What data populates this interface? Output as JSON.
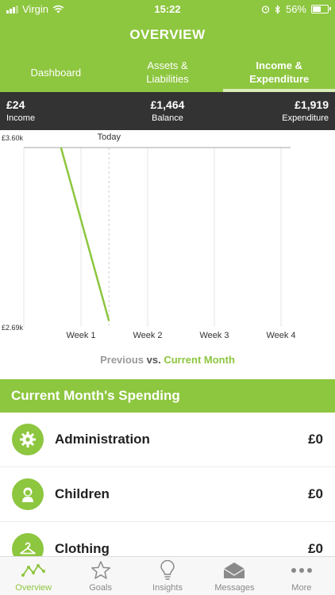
{
  "status": {
    "carrier": "Virgin",
    "time": "15:22",
    "battery": "56%",
    "battery_level": 0.56
  },
  "header": {
    "title": "OVERVIEW"
  },
  "tabs": [
    {
      "label": "Dashboard"
    },
    {
      "label": "Assets &\nLiabilities"
    },
    {
      "label": "Income &\nExpenditure"
    }
  ],
  "summary": {
    "income_value": "£24",
    "income_label": "Income",
    "balance_value": "£1,464",
    "balance_label": "Balance",
    "expenditure_value": "£1,919",
    "expenditure_label": "Expenditure"
  },
  "chart_data": {
    "type": "line",
    "ymax_label": "£3.60k",
    "ymin_label": "£2.69k",
    "ylim": [
      2690,
      3600
    ],
    "x_categories": [
      "Week 1",
      "Week 2",
      "Week 3",
      "Week 4"
    ],
    "today_label": "Today",
    "today_x": 1.42,
    "reference_line": 3600,
    "series": [
      {
        "values": [
          {
            "x": 0.7,
            "y": 3600
          },
          {
            "x": 1.42,
            "y": 2720
          }
        ],
        "color": "#8dc63f"
      }
    ]
  },
  "legend": {
    "previous": "Previous",
    "vs": "vs.",
    "current": "Current Month"
  },
  "section": {
    "title": "Current Month's Spending"
  },
  "spending": [
    {
      "label": "Administration",
      "amount": "£0",
      "icon": "gear-icon"
    },
    {
      "label": "Children",
      "amount": "£0",
      "icon": "child-icon"
    },
    {
      "label": "Clothing",
      "amount": "£0",
      "icon": "hanger-icon"
    }
  ],
  "tabbar": [
    {
      "label": "Overview",
      "icon": "overview-icon"
    },
    {
      "label": "Goals",
      "icon": "star-icon"
    },
    {
      "label": "Insights",
      "icon": "lightbulb-icon"
    },
    {
      "label": "Messages",
      "icon": "envelope-icon"
    },
    {
      "label": "More",
      "icon": "more-icon"
    }
  ],
  "colors": {
    "brand": "#8dc63f",
    "dark_bar": "#333333"
  }
}
